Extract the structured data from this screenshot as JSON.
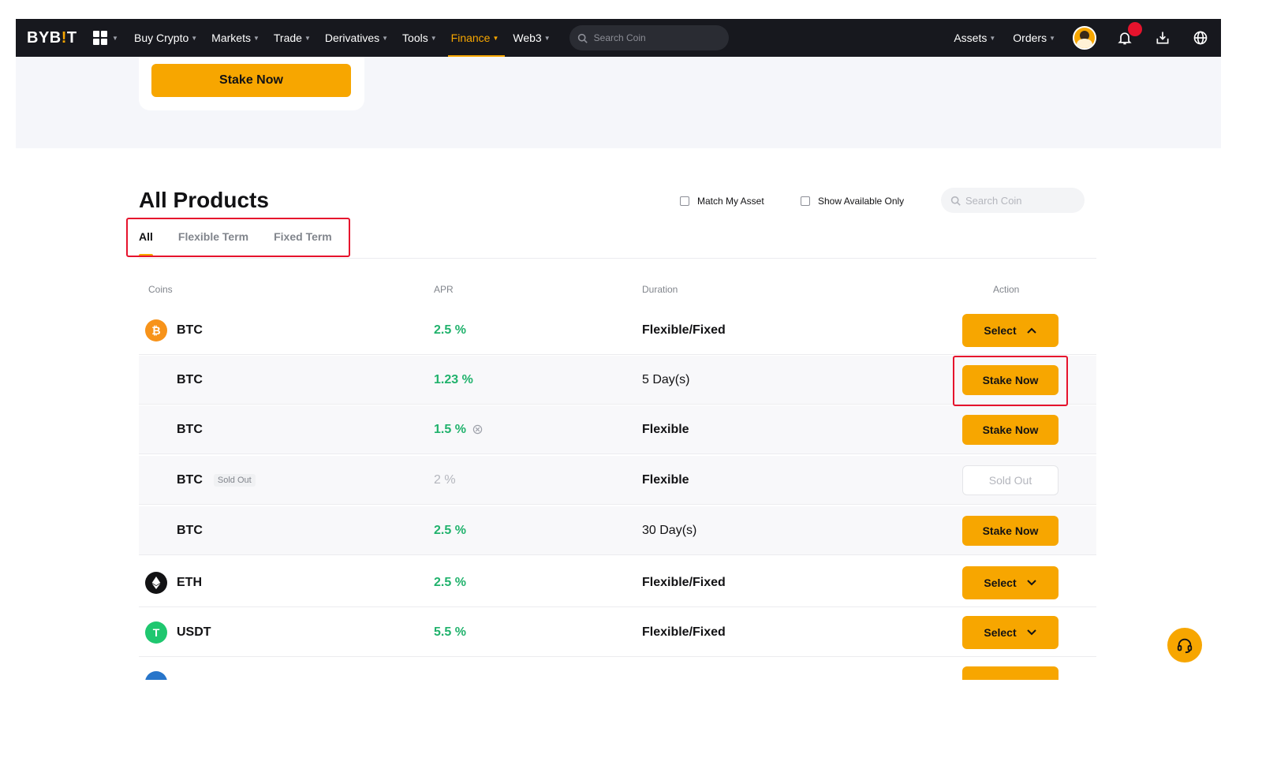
{
  "nav": {
    "logo_main": "BYB",
    "logo_mark": "!",
    "logo_end": "T",
    "items": [
      "Buy Crypto",
      "Markets",
      "Trade",
      "Derivatives",
      "Tools",
      "Finance",
      "Web3"
    ],
    "active_item": "Finance",
    "search_placeholder": "Search Coin",
    "right_items": [
      "Assets",
      "Orders"
    ]
  },
  "hero": {
    "stake_button": "Stake Now"
  },
  "products": {
    "title": "All Products",
    "filter_match": "Match My Asset",
    "filter_available": "Show Available Only",
    "search_placeholder": "Search Coin",
    "tabs": [
      "All",
      "Flexible Term",
      "Fixed Term"
    ],
    "active_tab": "All",
    "columns": [
      "Coins",
      "APR",
      "Duration",
      "Action"
    ],
    "rows": [
      {
        "coin": "BTC",
        "apr": "2.5 %",
        "duration": "Flexible/Fixed",
        "action": "Select",
        "icon": "btc-icon",
        "expanded": true
      },
      {
        "coin": "BTC",
        "apr": "1.23 %",
        "duration": "5 Day(s)",
        "action": "Stake Now"
      },
      {
        "coin": "BTC",
        "apr": "1.5 %",
        "duration": "Flexible",
        "action": "Stake Now",
        "apr_icon": "info-icon"
      },
      {
        "coin": "BTC",
        "tag": "Sold Out",
        "apr": "2 %",
        "duration": "Flexible",
        "action": "Sold Out"
      },
      {
        "coin": "BTC",
        "apr": "2.5 %",
        "duration": "30 Day(s)",
        "action": "Stake Now"
      },
      {
        "coin": "ETH",
        "apr": "2.5 %",
        "duration": "Flexible/Fixed",
        "action": "Select",
        "icon": "eth-icon"
      },
      {
        "coin": "USDT",
        "apr": "5.5 %",
        "duration": "Flexible/Fixed",
        "action": "Select",
        "icon": "usdt-icon",
        "icon_letter": "T"
      }
    ]
  },
  "colors": {
    "accent": "#f7a600",
    "nav_bg": "#17181e",
    "apr_green": "#20b26c",
    "highlight_red": "#e6132d"
  }
}
